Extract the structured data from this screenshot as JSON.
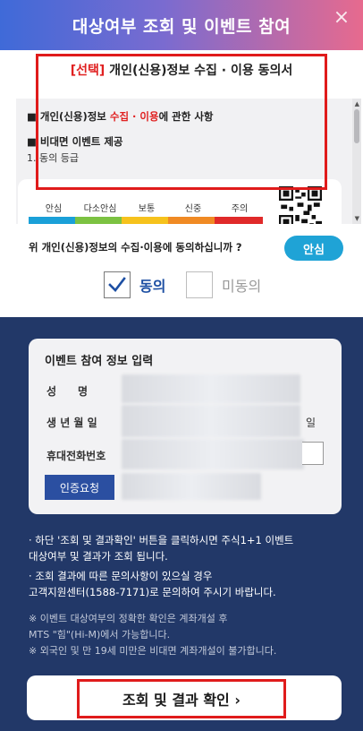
{
  "header": {
    "title": "대상여부 조회 및 이벤트 참여",
    "close_symbol": "×"
  },
  "subtitle": {
    "tag": "[선택]",
    "text": " 개인(신용)정보 수집 · 이용 동의서"
  },
  "terms": {
    "line1_prefix": "■ 개인(신용)정보 ",
    "line1_highlight": "수집 · 이용",
    "line1_suffix": "에 관한 사항",
    "line2": "■ 비대면 이벤트 제공",
    "line3": "1. 동의 등급",
    "grades": [
      "안심",
      "다소안심",
      "보통",
      "신중",
      "주의"
    ],
    "grade_colors": [
      "#1aa0d8",
      "#7cc242",
      "#f6c21c",
      "#f08a24",
      "#e02a2a"
    ]
  },
  "consent": {
    "question": "위 개인(신용)정보의 수집·이용에 동의하십니까 ?",
    "badge": "안심",
    "agree_label": "동의",
    "disagree_label": "미동의"
  },
  "form": {
    "title": "이벤트 참여 정보 입력",
    "name_label": "성　　명",
    "birth_label": "생 년 월 일",
    "birth_suffix": "일",
    "phone_label": "휴대전화번호",
    "auth_button": "인증요청"
  },
  "notes": {
    "n1a": "· 하단 '조회 및 결과확인' 버튼을 클릭하시면 주식1+1 이벤트",
    "n1b": "  대상여부 및 결과가 조회 됩니다.",
    "n2a": "· 조회 결과에 따른 문의사항이 있으실 경우",
    "n2b": "  고객지원센터(1588-7171)로 문의하여 주시기 바랍니다.",
    "n3a": "※ 이벤트 대상여부의 정확한 확인은 계좌개설 후",
    "n3b": "    MTS \"힘\"(Hi-M)에서 가능합니다.",
    "n4": "※ 외국인 및 만 19세 미만은 비대면 계좌개설이 불가합니다."
  },
  "footer": {
    "button_label": "조회 및 결과 확인 ›"
  },
  "colors": {
    "navy": "#223868",
    "accent_red": "#e01b1b",
    "badge_blue": "#1fa3d6"
  }
}
